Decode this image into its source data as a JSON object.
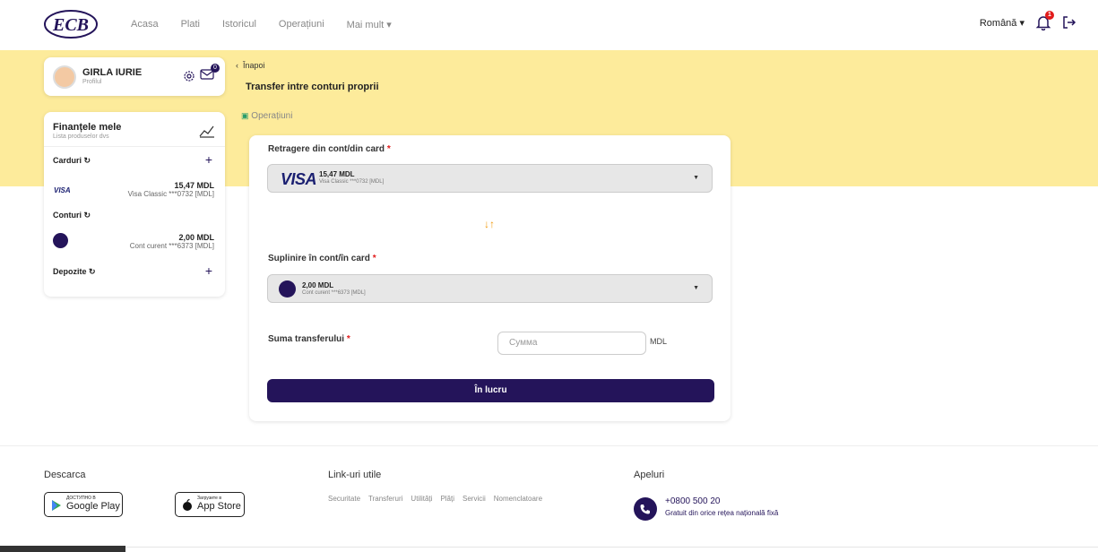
{
  "nav": {
    "logo_text": "ECB",
    "links": [
      "Acasa",
      "Plati",
      "Istoricul",
      "Operațiuni",
      "Mai mult ▾"
    ],
    "language": "Română ▾",
    "notification_count": "1"
  },
  "profile": {
    "name": "GIRLA IURIE",
    "sub": "Profilul",
    "message_count": "0"
  },
  "finance": {
    "title": "Finanțele mele",
    "subtitle": "Lista produselor dvs",
    "cards_label": "Carduri",
    "card_brand": "VISA",
    "card_amount": "15,47  MDL",
    "card_desc": "Visa Classic ***0732 [MDL]",
    "accounts_label": "Conturi",
    "account_amount": "2,00  MDL",
    "account_desc": "Cont curent ***6373 [MDL]",
    "deposits_label": "Depozite"
  },
  "page": {
    "back": "Înapoi",
    "title": "Transfer intre conturi proprii",
    "ops": "Operațiuni"
  },
  "form": {
    "from_label": "Retragere din cont/din card",
    "from_brand": "VISA",
    "from_amount": "15,47 MDL",
    "from_desc": "Visa Classic ***0732 [MDL]",
    "to_label": "Suplinire în cont/în card",
    "to_amount": "2,00 MDL",
    "to_desc": "Cont curent ***6373 [MDL]",
    "sum_label": "Suma transferului",
    "sum_placeholder": "Сумма",
    "currency": "MDL",
    "submit": "În lucru",
    "required_mark": "*"
  },
  "footer": {
    "download_title": "Descarca",
    "google_small": "ДОСТУПНО В",
    "google_big": "Google Play",
    "apple_small": "Загрузите в",
    "apple_big": "App Store",
    "links_title": "Link-uri utile",
    "links": [
      "Securitate",
      "Transferuri",
      "Utilități",
      "Plăți",
      "Servicii",
      "Nomenclatoare"
    ],
    "calls_title": "Apeluri",
    "phone": "+0800 500 20",
    "phone_sub": "Gratuit din orice rețea națională fixă"
  },
  "colors": {
    "brand": "#24145a",
    "banner": "#fdeb9b",
    "accent": "#f29b10",
    "alert": "#e21b1b"
  }
}
